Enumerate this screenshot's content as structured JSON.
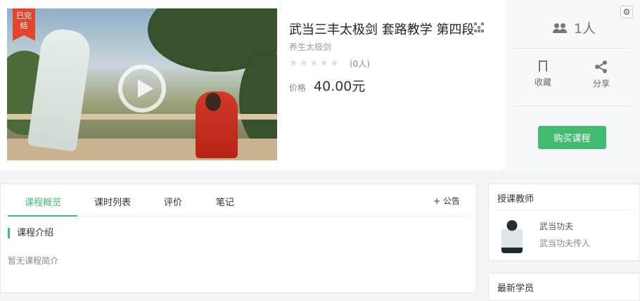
{
  "course": {
    "badge": "已完结",
    "title": "武当三丰太极剑 套路教学 第四段",
    "subtitle": "养生太极剑",
    "rating_stars": 0,
    "rating_count": "(0人)",
    "price_label": "价格",
    "price": "40.00元"
  },
  "side": {
    "student_count": "1人",
    "favorite_label": "收藏",
    "share_label": "分享",
    "buy_label": "购买课程"
  },
  "tabs": {
    "items": [
      "课程概览",
      "课时列表",
      "评价",
      "笔记"
    ],
    "notice": "+ 公告"
  },
  "intro": {
    "heading": "课程介绍",
    "empty_text": "暂无课程简介"
  },
  "teacher": {
    "heading": "授课教师",
    "name": "武当功夫",
    "desc": "武当功夫传人"
  },
  "latest_students": {
    "heading": "最新学员"
  },
  "colors": {
    "accent": "#43bc72",
    "badge": "#e2452b"
  }
}
